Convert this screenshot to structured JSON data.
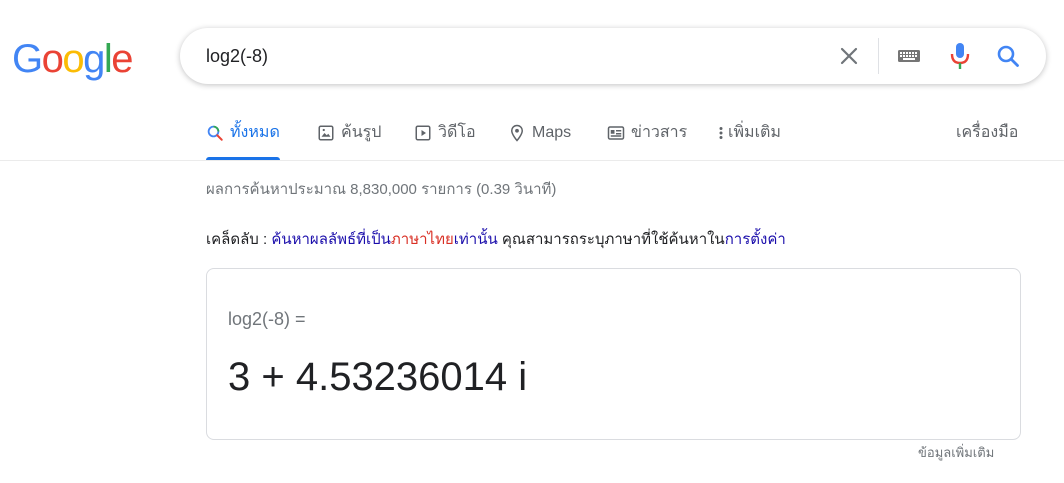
{
  "logo": {
    "letters": [
      "G",
      "o",
      "o",
      "g",
      "l",
      "e"
    ],
    "colors": [
      "#4285F4",
      "#EA4335",
      "#FBBC05",
      "#4285F4",
      "#34A853",
      "#EA4335"
    ]
  },
  "search": {
    "value": "log2(-8)",
    "icons": [
      "close-icon",
      "keyboard-icon",
      "microphone-icon",
      "search-icon"
    ]
  },
  "tabs": [
    {
      "label": "ทั้งหมด",
      "icon": "search-icon",
      "active": true
    },
    {
      "label": "ค้นรูป",
      "icon": "image-icon",
      "active": false
    },
    {
      "label": "วิดีโอ",
      "icon": "video-icon",
      "active": false
    },
    {
      "label": "Maps",
      "icon": "map-pin-icon",
      "active": false
    },
    {
      "label": "ข่าวสาร",
      "icon": "news-icon",
      "active": false
    },
    {
      "label": "เพิ่มเติม",
      "icon": "more-vert-icon",
      "active": false
    }
  ],
  "tools_label": "เครื่องมือ",
  "stats": "ผลการค้นหาประมาณ 8,830,000 รายการ (0.39 วินาที)",
  "tip": {
    "prefix": "เคล็ดลับ : ",
    "link1": "ค้นหาผลลัพธ์ที่เป็น",
    "link_red": "ภาษาไทย",
    "link1_end": "เท่านั้น",
    "middle": " คุณสามารถระบุภาษาที่ใช้ค้นหาใน",
    "link2": "การตั้งค่า"
  },
  "calculator": {
    "expression": "log2(-8) =",
    "result": "3 + 4.53236014 i"
  },
  "more_info": "ข้อมูลเพิ่มเติม",
  "colors": {
    "accent": "#1a73e8",
    "link": "#1a0dab",
    "red_link": "#d93025",
    "muted": "#70757a"
  }
}
